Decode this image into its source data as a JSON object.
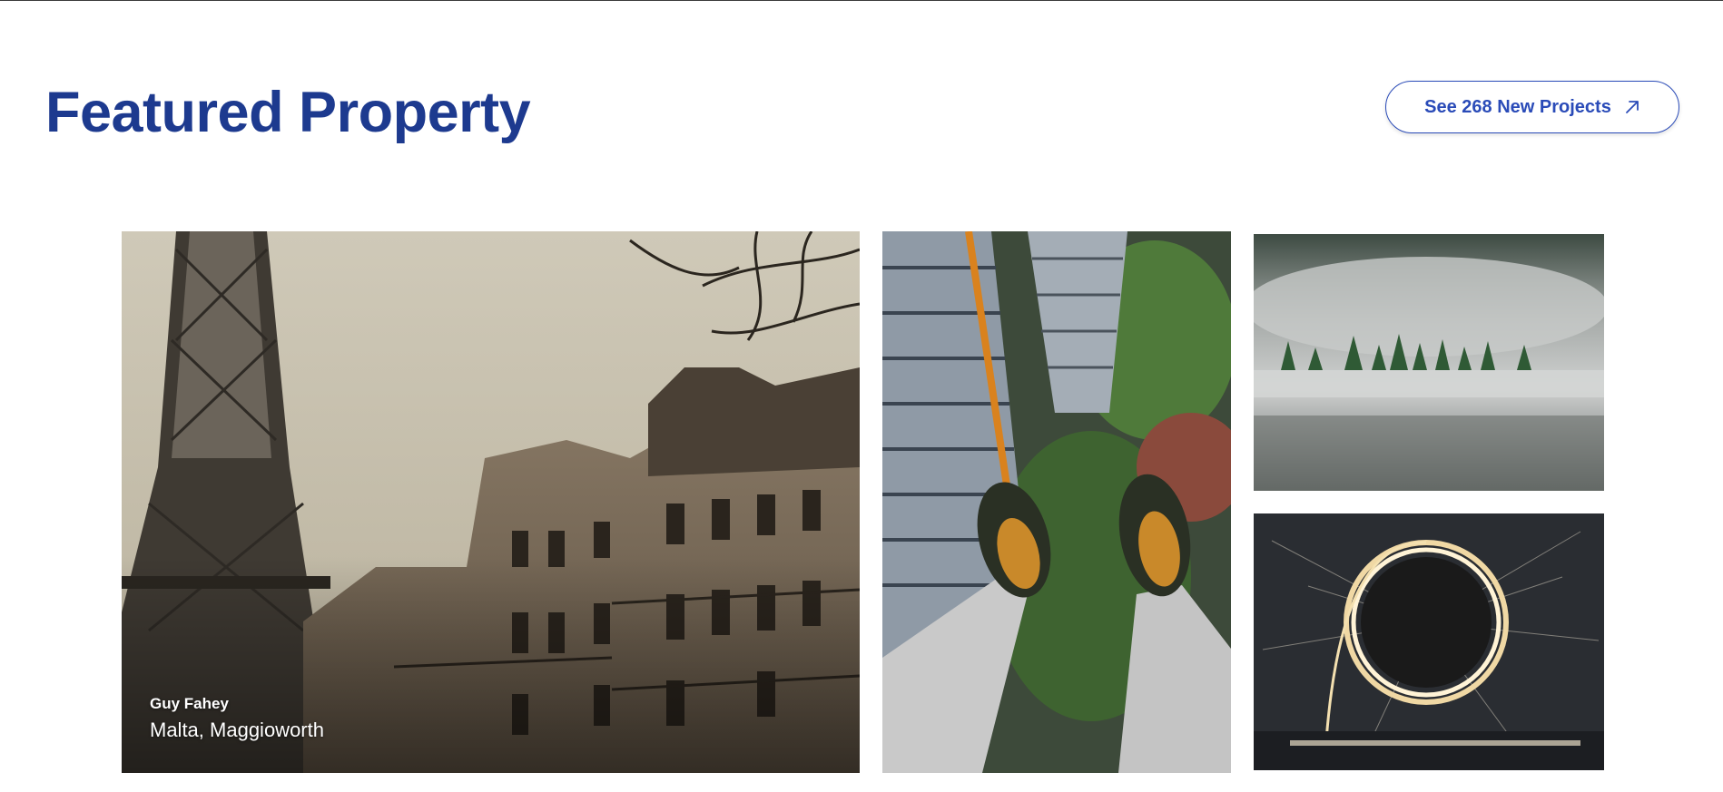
{
  "section": {
    "title": "Featured Property",
    "cta_label": "See 268 New Projects",
    "cta_icon": "arrow-up-right-icon"
  },
  "colors": {
    "title": "#1d3a8f",
    "cta_border": "#2a4bb8",
    "cta_text": "#2a4bb8",
    "background": "#ffffff"
  },
  "cards": [
    {
      "image": "paris-eiffel-tower-buildings",
      "agent": "Guy Fahey",
      "location": "Malta, Maggioworth"
    },
    {
      "image": "feet-over-skyscrapers"
    },
    {
      "image": "misty-forest-lake"
    },
    {
      "image": "steel-wool-light-ring"
    }
  ]
}
